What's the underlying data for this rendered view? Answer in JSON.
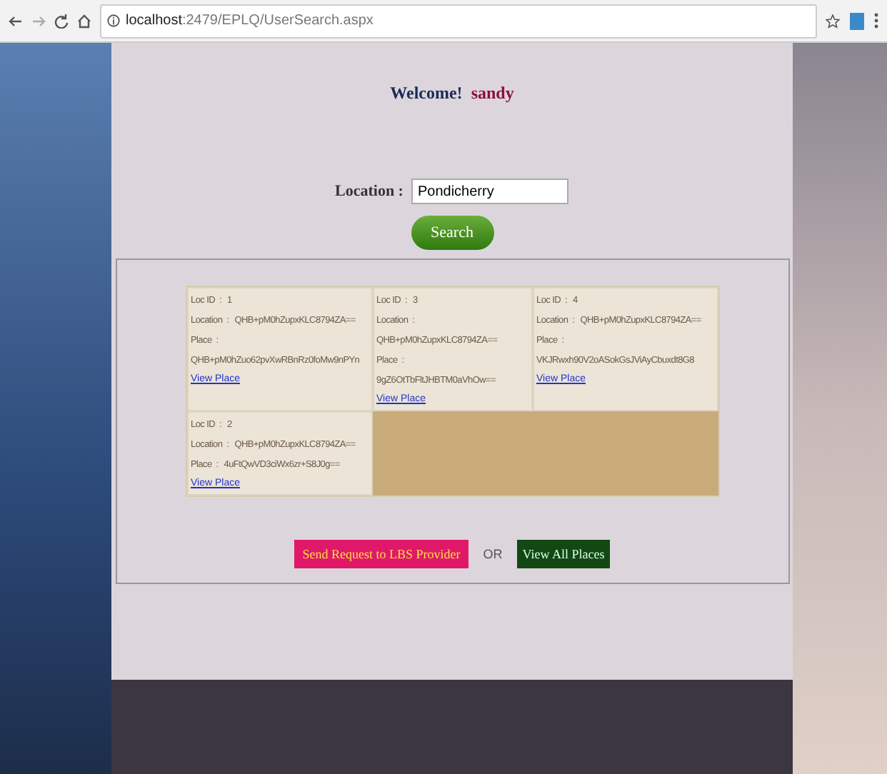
{
  "browser": {
    "url_host": "localhost",
    "url_path": ":2479/EPLQ/UserSearch.aspx"
  },
  "welcome": {
    "label": "Welcome!",
    "user": "sandy"
  },
  "search": {
    "label": "Location :",
    "value": "Pondicherry",
    "button": "Search"
  },
  "results": [
    {
      "id_label": "Loc ID  :",
      "id": "1",
      "location_label": "Location  :",
      "location": "QHB+pM0hZupxKLC8794ZA==",
      "place_label": "Place  :",
      "place": "QHB+pM0hZuo62pvXwRBnRz0foMw9nPYn",
      "link": "View Place"
    },
    {
      "id_label": "Loc ID  :",
      "id": "3",
      "location_label": "Location  :",
      "location": "QHB+pM0hZupxKLC8794ZA==",
      "place_label": "Place  :",
      "place": "9gZ6OtTbFltJHBTM0aVhOw==",
      "link": "View Place"
    },
    {
      "id_label": "Loc ID  :",
      "id": "4",
      "location_label": "Location  :",
      "location": "QHB+pM0hZupxKLC8794ZA==",
      "place_label": "Place  :",
      "place": "VKJRwxh90V2oASokGsJViAyCbuxdt8G8",
      "link": "View Place"
    },
    {
      "id_label": "Loc ID  :",
      "id": "2",
      "location_label": "Location  :",
      "location": "QHB+pM0hZupxKLC8794ZA==",
      "place_label": "Place  :",
      "place": "4uFtQwVD3ciWx6zr+S8J0g==",
      "link": "View Place"
    }
  ],
  "actions": {
    "send": "Send Request to LBS Provider",
    "or": "OR",
    "view_all": "View All Places"
  }
}
